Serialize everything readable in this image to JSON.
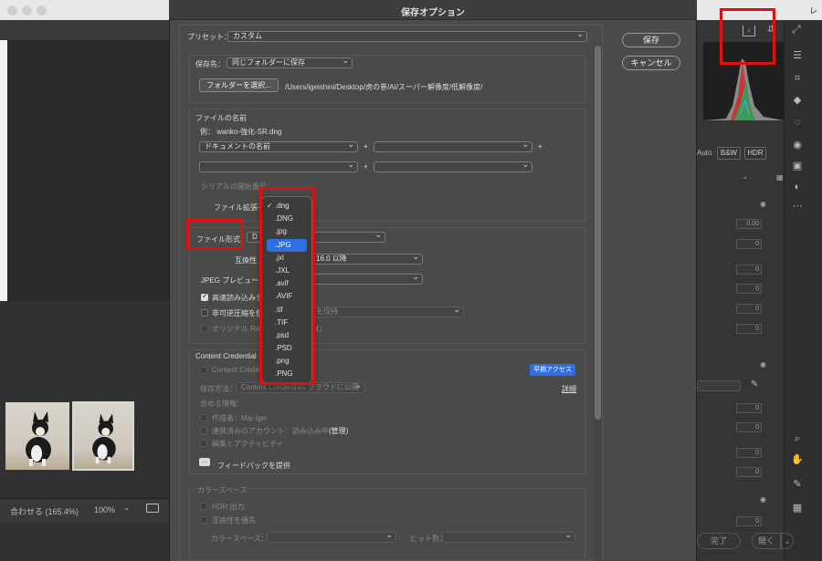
{
  "dialog": {
    "title": "保存オプション"
  },
  "preset": {
    "label": "プリセット：",
    "value": "カスタム"
  },
  "buttons": {
    "save": "保存",
    "cancel": "キャンセル"
  },
  "destination": {
    "label": "保存先：",
    "value": "同じフォルダーに保存",
    "choose_button": "フォルダーを選択...",
    "path": "/Users/igeishini/Desktop/虎の巻/AI/スーパー解像度/低解像度/"
  },
  "filename": {
    "heading": "ファイルの名前",
    "example": "例： wanko-強化-SR.dng",
    "field1": "ドキュメントの名前",
    "plus": "+",
    "serial_label": "シリアルの開始番号：",
    "extension_label": "ファイル拡張子"
  },
  "format": {
    "label": "ファイル形式：",
    "value_prefix": "D",
    "value_suffix": "NG)",
    "compat_label": "互換性",
    "compat_value": "16.0 以降",
    "jpeg_preview_label": "JPEG プレビュー：",
    "fast_load": "高速読み込みデ",
    "lossy": "非可逆圧縮を使用",
    "lossy_suffix": "を保持",
    "embed_original": "オリジナル Ra",
    "embed_suffix": "む"
  },
  "extension_menu": [
    {
      "label": ".dng",
      "checked": true
    },
    {
      "label": ".DNG"
    },
    {
      "label": ".jpg"
    },
    {
      "label": ".JPG",
      "highlighted": true
    },
    {
      "label": ".jxl"
    },
    {
      "label": ".JXL"
    },
    {
      "label": ".avif"
    },
    {
      "label": ".AVIF"
    },
    {
      "label": ".tif"
    },
    {
      "label": ".TIF"
    },
    {
      "label": ".psd"
    },
    {
      "label": ".PSD"
    },
    {
      "label": ".png"
    },
    {
      "label": ".PNG"
    }
  ],
  "content_credentials": {
    "heading": "Content Credential",
    "checkbox": "Content Credenti",
    "early_access": "早期アクセス",
    "details": "詳細",
    "save_method_label": "保存方法：",
    "save_method_value": "Content Credentials クラウドに公開",
    "include_label": "含める情報：",
    "author": "作成者：Mai Igei",
    "account": "連携済みのアカウント：読み込み中...",
    "manage": "(管理)",
    "edit_activity": "編集とアクティビティ",
    "feedback": "フィードバックを提供"
  },
  "color_space": {
    "heading": "カラースペース",
    "hdr": "HDR 出力",
    "prioritize_compat": "互換性を優先",
    "colorspace_label": "カラースペース：",
    "bitdepth_label": "ビット数："
  },
  "background": {
    "zoom_fit": "合わせる (165.4%)",
    "zoom_pct": "100%",
    "auto": "Auto",
    "bw": "B&W",
    "hdr": "HDR",
    "r00": "0.00",
    "r0": "0",
    "done": "完了",
    "open": "開く",
    "edge_letter": "レ"
  },
  "colors": {
    "accent": "#2f6ee3",
    "annotation_red": "#e11010",
    "dialog_bg": "#4a4a4a",
    "window_bg": "#2b2b2b"
  }
}
